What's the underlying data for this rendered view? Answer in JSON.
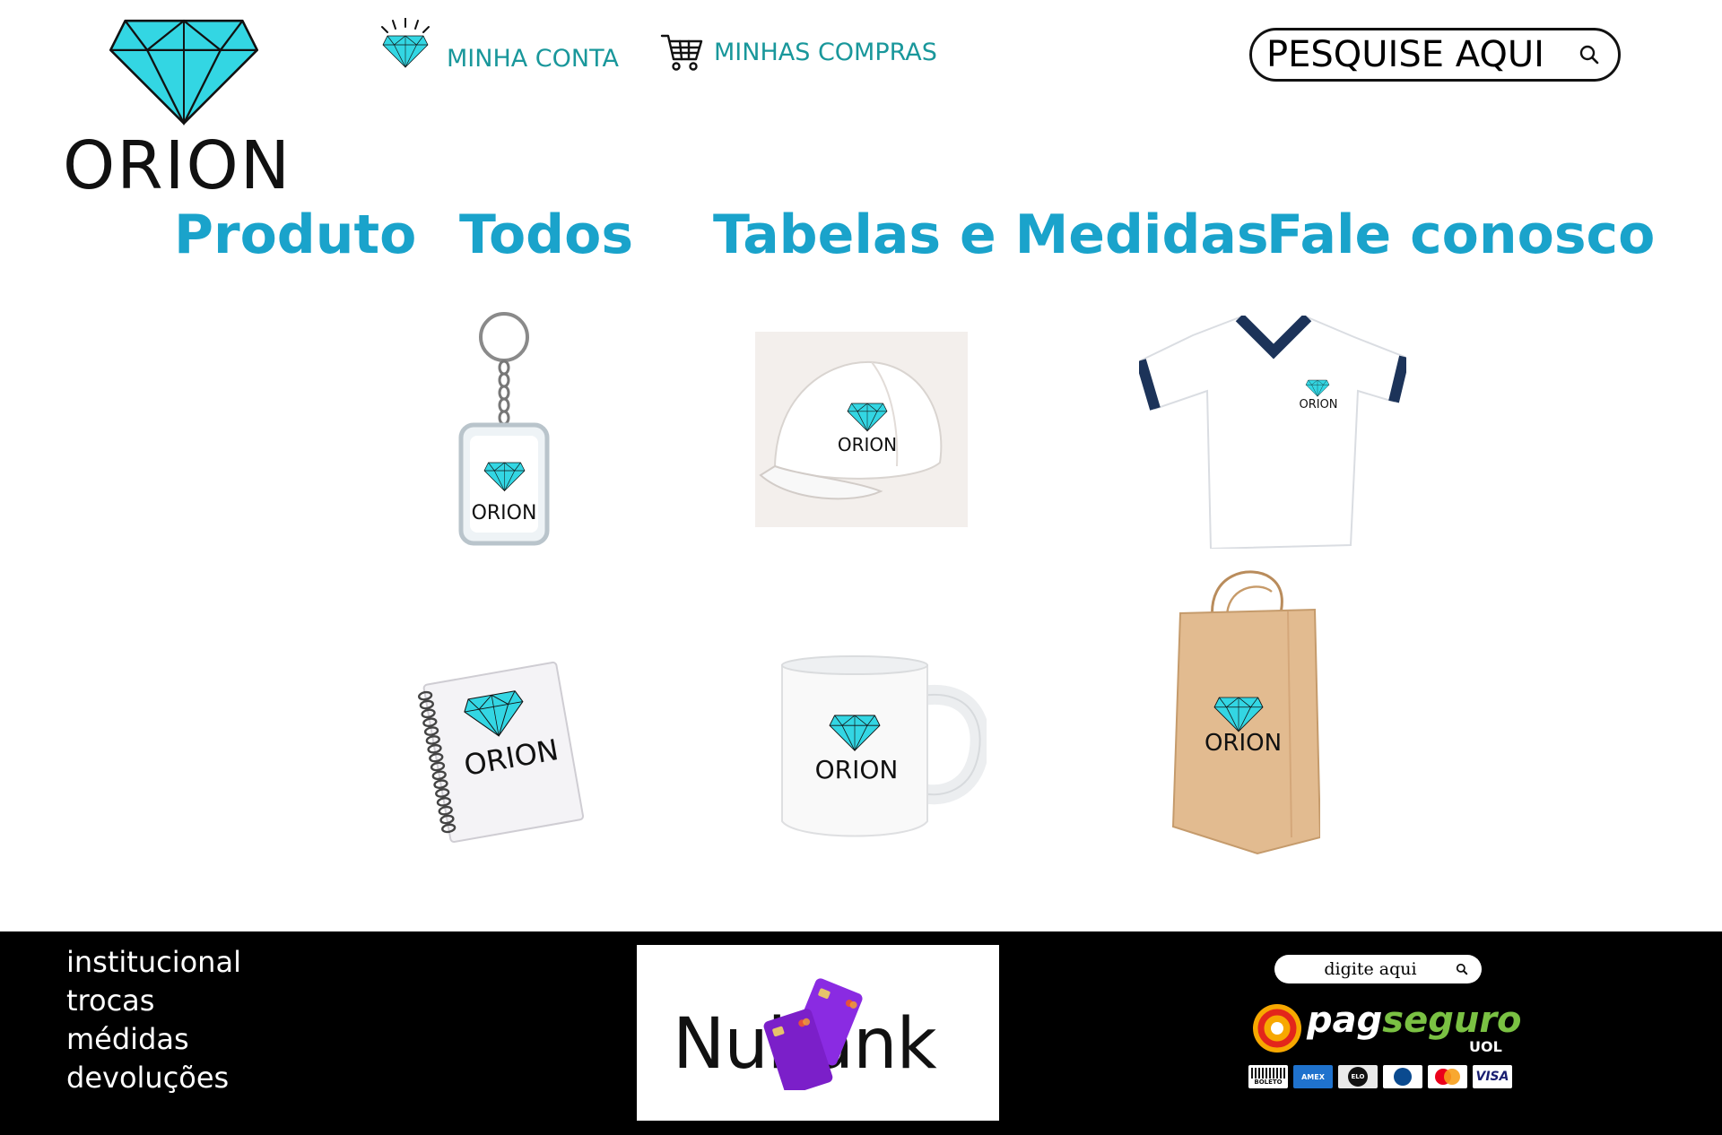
{
  "header": {
    "brand": "ORION",
    "account_label": "MINHA CONTA",
    "purchases_label": "MINHAS COMPRAS",
    "search_placeholder": "PESQUISE AQUI"
  },
  "nav": {
    "items": [
      "Produto",
      "Todos",
      "Tabelas e Medidas",
      "Fale conosco"
    ]
  },
  "products": {
    "keychain_brand": "ORION",
    "cap_brand": "ORION",
    "shirt_brand": "ORION",
    "notebook_brand": "ORION",
    "mug_brand": "ORION",
    "bag_brand": "ORION"
  },
  "footer": {
    "links": [
      "institucional",
      "trocas",
      "médidas",
      "devoluções"
    ],
    "bank_name": "Nubank",
    "search_placeholder": "digite aqui",
    "payment_brand_main": "pag",
    "payment_brand_accent": "seguro",
    "payment_brand_sub": "UOL",
    "payment_methods": [
      "BOLETO",
      "AMEX",
      "ELO",
      "DINERS",
      "MASTERCARD",
      "VISA"
    ]
  },
  "colors": {
    "brand_teal": "#19979b",
    "nav_blue": "#1aa3cb",
    "diamond_cyan": "#33d6e3",
    "footer_bg": "#000000"
  }
}
